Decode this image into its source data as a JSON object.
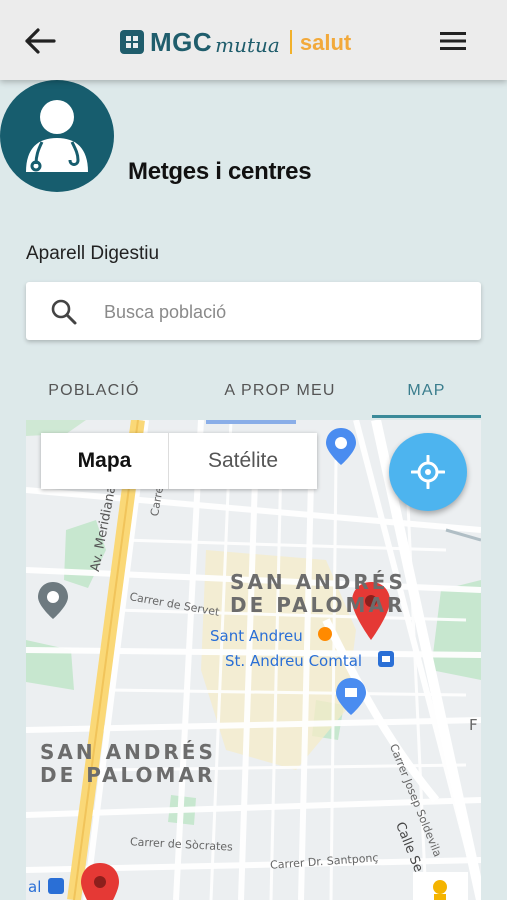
{
  "app": {
    "logo_brand": "MGC",
    "logo_sub": "mutua",
    "logo_product": "salut"
  },
  "header": {
    "title": "Metges i centres",
    "specialty": "Aparell Digestiu"
  },
  "search": {
    "placeholder": "Busca població",
    "value": ""
  },
  "tabs": [
    {
      "label": "POBLACIÓ",
      "active": false
    },
    {
      "label": "A PROP MEU",
      "active": false
    },
    {
      "label": "MAP",
      "active": true
    }
  ],
  "map": {
    "type_selector": {
      "selected": "Mapa",
      "other": "Satélite"
    },
    "labels": {
      "district_top": [
        "SAN ANDRÉS",
        "DE PALOMAR"
      ],
      "district_bottom": [
        "SAN ANDRÉS",
        "DE PALOMAR"
      ],
      "station_1": "Sant Andreu",
      "station_2": "St. Andreu Comtal",
      "avenue": "Av. Meridiana",
      "street_servet": "Carrer de Servet",
      "street_socrates": "Carrer de Sòcrates",
      "street_santponc": "Carrer Dr. Santponç",
      "street_soldevila": "Carrer Josep Soldevila",
      "street_calle": "Calle Se",
      "street_partial": "Carre",
      "partial_letter": "F",
      "partial_station": "al"
    },
    "markers": 2
  },
  "colors": {
    "accent": "#3a8a99",
    "brand_teal": "#1f5d6c",
    "brand_orange": "#f2a93b",
    "fab": "#4db4ef",
    "marker": "#e53935"
  }
}
